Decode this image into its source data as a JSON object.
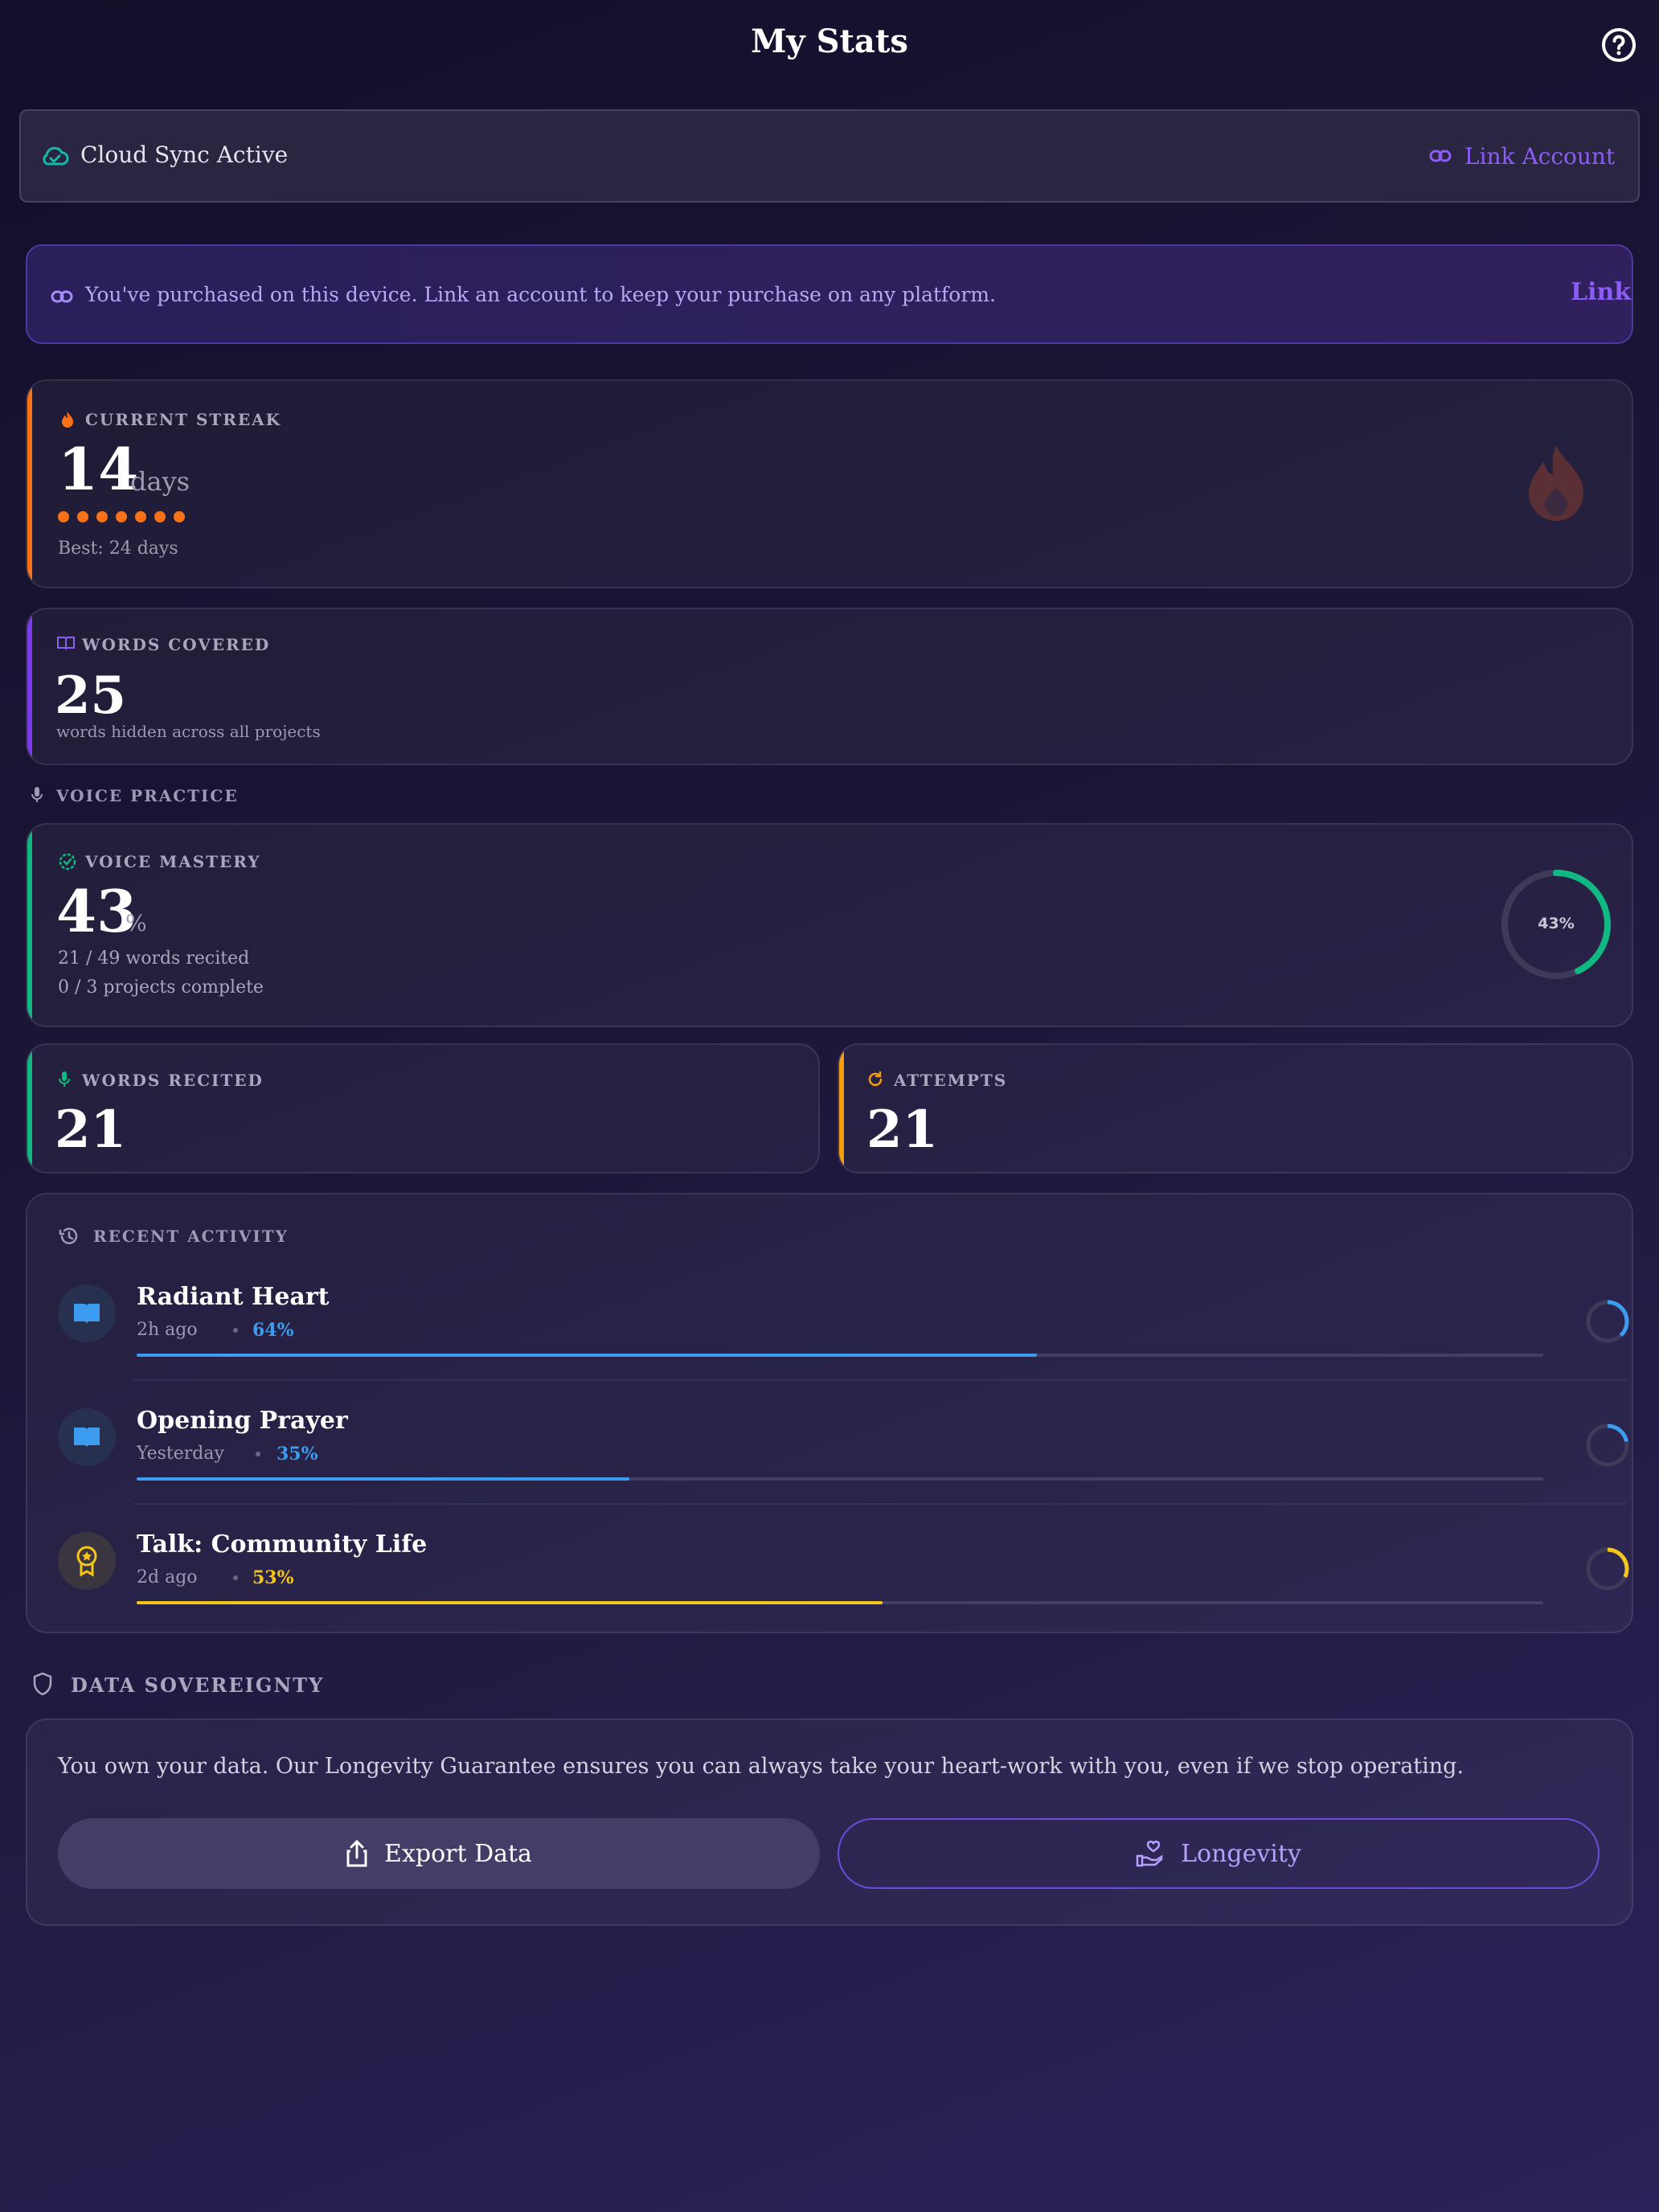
{
  "header": {
    "title": "My Stats",
    "help_icon": "help-circle-icon"
  },
  "sync": {
    "status": "Cloud Sync Active",
    "link_label": "Link Account",
    "accent": "#8b5cf6",
    "icon_color": "#14b8a6"
  },
  "purchase_banner": {
    "message": "You've purchased on this device. Link an account to keep your purchase on any platform.",
    "link_label": "Link"
  },
  "streak": {
    "label": "CURRENT STREAK",
    "value": "14",
    "unit": "days",
    "dots": 7,
    "best": "Best: 24 days",
    "color": "#f97316"
  },
  "words_covered": {
    "label": "WORDS COVERED",
    "value": "25",
    "caption": "words hidden across all projects",
    "color": "#7c3aed"
  },
  "voice_section": {
    "label": "VOICE PRACTICE"
  },
  "voice_mastery": {
    "label": "VOICE MASTERY",
    "value": "43",
    "unit": "%",
    "line1": "21 / 49 words recited",
    "line2": "0 / 3 projects complete",
    "ring_label": "43%",
    "progress": 0.43,
    "color": "#10b981"
  },
  "words_recited": {
    "label": "WORDS RECITED",
    "value": "21",
    "color": "#10b981"
  },
  "attempts": {
    "label": "ATTEMPTS",
    "value": "21",
    "color": "#f59e0b"
  },
  "recent": {
    "label": "RECENT ACTIVITY",
    "items": [
      {
        "title": "Radiant Heart",
        "time": "2h ago",
        "percent": "64%",
        "progress": 0.64,
        "color": "#3b9cf0",
        "icon": "book-open-icon"
      },
      {
        "title": "Opening Prayer",
        "time": "Yesterday",
        "percent": "35%",
        "progress": 0.35,
        "color": "#3b9cf0",
        "icon": "book-open-icon"
      },
      {
        "title": "Talk: Community Life",
        "time": "2d ago",
        "percent": "53%",
        "progress": 0.53,
        "color": "#f5c518",
        "icon": "award-icon"
      }
    ]
  },
  "sovereignty": {
    "label": "DATA SOVEREIGNTY",
    "text": "You own your data. Our Longevity Guarantee ensures you can always take your heart-work with you, even if we stop operating.",
    "export_label": "Export Data",
    "longevity_label": "Longevity"
  }
}
